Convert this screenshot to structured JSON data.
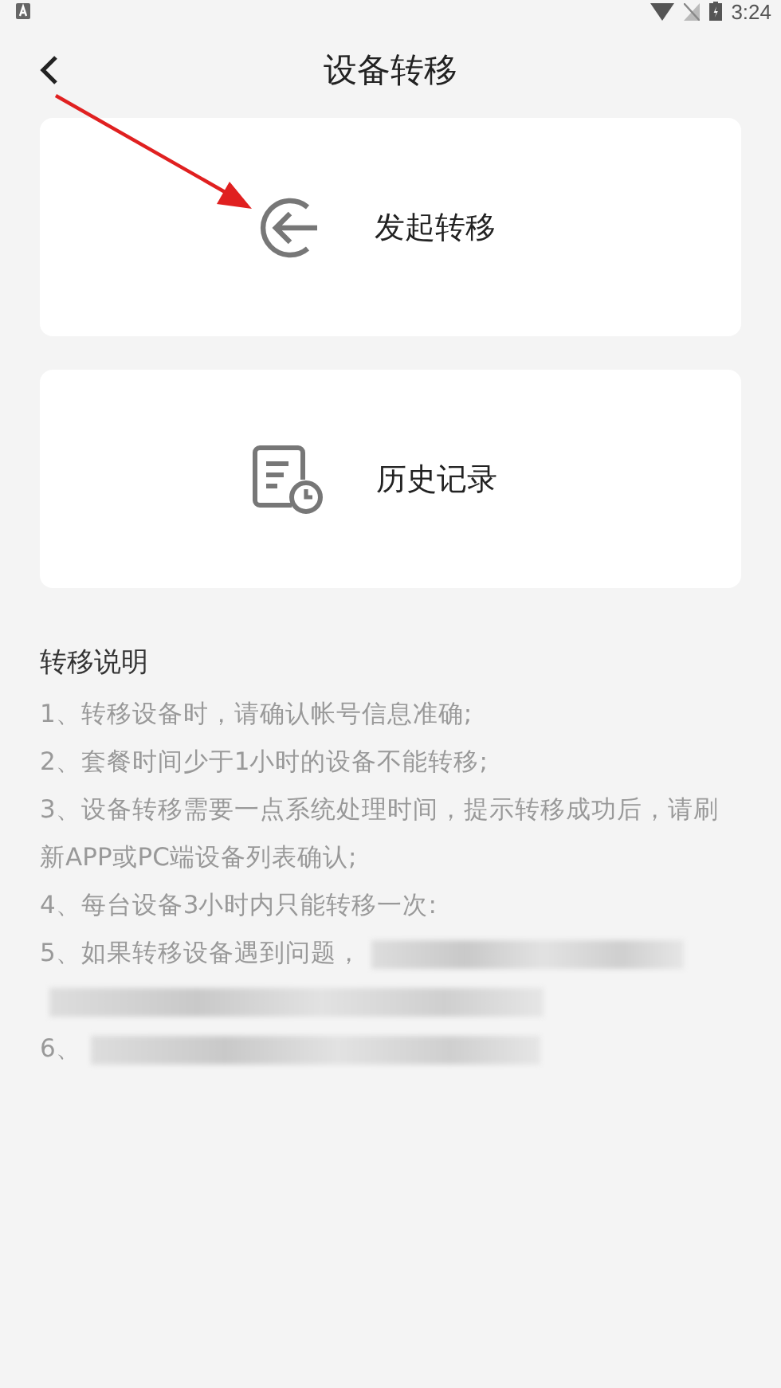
{
  "status_bar": {
    "time": "3:24"
  },
  "header": {
    "title": "设备转移"
  },
  "actions": [
    {
      "kind": "transfer",
      "label": "发起转移"
    },
    {
      "kind": "history",
      "label": "历史记录"
    }
  ],
  "notes": {
    "title": "转移说明",
    "items": [
      {
        "text": "1、转移设备时，请确认帐号信息准确;"
      },
      {
        "text": "2、套餐时间少于1小时的设备不能转移;"
      },
      {
        "text": "3、设备转移需要一点系统处理时间，提示转移成功后，请刷新APP或PC端设备列表确认;"
      },
      {
        "text": "4、每台设备3小时内只能转移一次:"
      },
      {
        "text": "5、如果转移设备遇到问题，",
        "redacted": [
          {
            "kind": "partial"
          },
          {
            "kind": "line"
          }
        ]
      },
      {
        "text": "6、",
        "redacted": [
          {
            "kind": "rest"
          }
        ]
      }
    ]
  }
}
